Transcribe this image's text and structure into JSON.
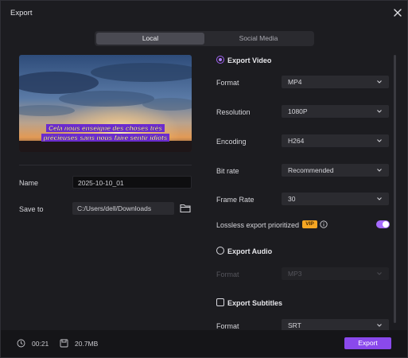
{
  "window": {
    "title": "Export",
    "close_icon": "close-icon"
  },
  "tabs": [
    {
      "label": "Local",
      "active": true
    },
    {
      "label": "Social Media",
      "active": false
    }
  ],
  "preview": {
    "caption_line1": "Cela nous enseigne des choses très",
    "caption_line2": "précieuses sans nous faire sentir idiots"
  },
  "left": {
    "name_label": "Name",
    "name_value": "2025-10-10_01",
    "save_label": "Save to",
    "save_value": "C:/Users/dell/Downloads",
    "folder_icon": "folder-icon"
  },
  "export_video": {
    "label": "Export Video",
    "selected": true,
    "format": {
      "label": "Format",
      "value": "MP4"
    },
    "resolution": {
      "label": "Resolution",
      "value": "1080P"
    },
    "encoding": {
      "label": "Encoding",
      "value": "H264"
    },
    "bitrate": {
      "label": "Bit rate",
      "value": "Recommended"
    },
    "framerate": {
      "label": "Frame Rate",
      "value": "30"
    },
    "lossless": {
      "label": "Lossless export prioritized",
      "badge": "VIP",
      "enabled": true
    }
  },
  "export_audio": {
    "label": "Export Audio",
    "selected": false,
    "format": {
      "label": "Format",
      "value": "MP3"
    }
  },
  "export_subtitles": {
    "label": "Export Subtitles",
    "checked": false,
    "format": {
      "label": "Format",
      "value": "SRT"
    }
  },
  "footer": {
    "duration": "00:21",
    "size": "20.7MB",
    "export_label": "Export"
  },
  "colors": {
    "accent": "#8a49ec",
    "vip": "#f5a623",
    "background": "#1c1c20"
  }
}
